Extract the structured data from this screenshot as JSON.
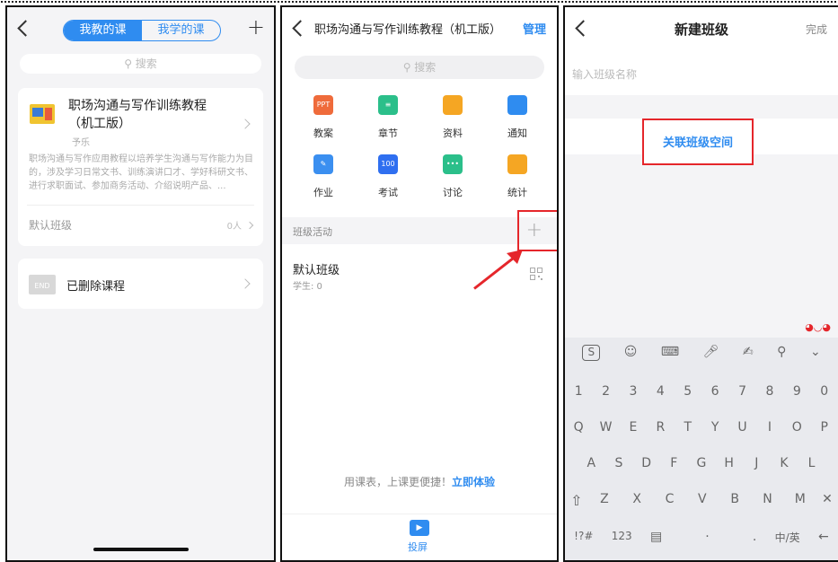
{
  "panel1": {
    "tabs": [
      "我教的课",
      "我学的课"
    ],
    "search_placeholder": "搜索",
    "course": {
      "title_line1": "职场沟通与写作训练教程",
      "title_line2": "（机工版）",
      "author": "予乐",
      "description": "职场沟通与写作应用教程以培养学生沟通与写作能力为目的，涉及学习日常文书、训练演讲口才、学好科研文书、进行求职面试、参加商务活动、介绍说明产品、...",
      "default_class": "默认班级",
      "count": "0人"
    },
    "deleted": {
      "icon_text": "END",
      "label": "已删除课程"
    }
  },
  "panel2": {
    "title": "职场沟通与写作训练教程（机工版）",
    "manage": "管理",
    "search_placeholder": "搜索",
    "grid": [
      {
        "label": "教案",
        "icon": "ppt-icon",
        "color": "#ef6b3b",
        "text": "PPT"
      },
      {
        "label": "章节",
        "icon": "chapter-icon",
        "color": "#2bbf8a",
        "text": "≡"
      },
      {
        "label": "资料",
        "icon": "folder-icon",
        "color": "#f5a623",
        "text": ""
      },
      {
        "label": "通知",
        "icon": "speaker-icon",
        "color": "#2f8cf0",
        "text": ""
      },
      {
        "label": "作业",
        "icon": "homework-icon",
        "color": "#3b8ff0",
        "text": "✎"
      },
      {
        "label": "考试",
        "icon": "exam-icon",
        "color": "#2f6ff0",
        "text": "100"
      },
      {
        "label": "讨论",
        "icon": "discuss-icon",
        "color": "#2bbf8a",
        "text": "•••"
      },
      {
        "label": "统计",
        "icon": "pie-icon",
        "color": "#f5a623",
        "text": ""
      }
    ],
    "section_label": "班级活动",
    "class_name": "默认班级",
    "students": "学生: 0",
    "promo_text": "用课表，上课更便捷！",
    "promo_link": "立即体验",
    "bottom_label": "投屏"
  },
  "panel3": {
    "title": "新建班级",
    "done": "完成",
    "input_placeholder": "输入班级名称",
    "link_button": "关联班级空间",
    "keyboard": {
      "numbers": [
        "1",
        "2",
        "3",
        "4",
        "5",
        "6",
        "7",
        "8",
        "9",
        "0"
      ],
      "row1": [
        "Q",
        "W",
        "E",
        "R",
        "T",
        "Y",
        "U",
        "I",
        "O",
        "P"
      ],
      "row1_hints": [
        "",
        "",
        "",
        "",
        "",
        "",
        "",
        "",
        "",
        ""
      ],
      "row2": [
        "A",
        "S",
        "D",
        "F",
        "G",
        "H",
        "J",
        "K",
        "L"
      ],
      "row3": [
        "Z",
        "X",
        "C",
        "V",
        "B",
        "N",
        "M"
      ],
      "sym_key": "!?#",
      "num_key": "123",
      "lang_key": "中/英"
    }
  }
}
